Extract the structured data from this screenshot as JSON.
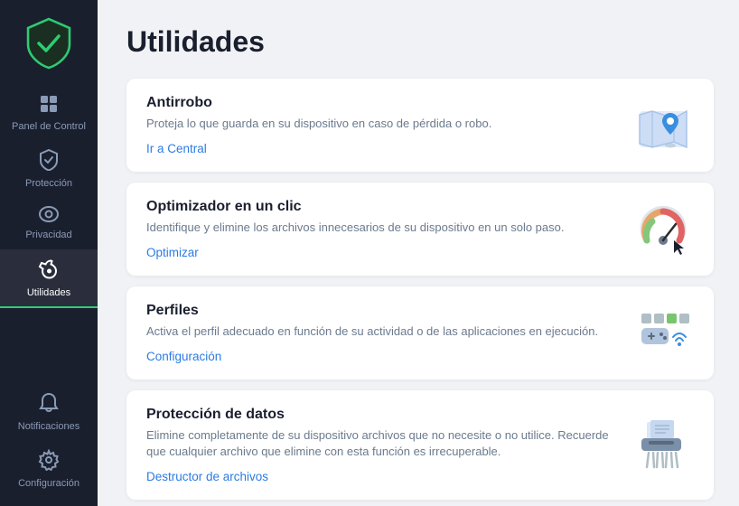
{
  "sidebar": {
    "items": [
      {
        "id": "panel",
        "label": "Panel de Control",
        "icon": "⊞",
        "active": false
      },
      {
        "id": "proteccion",
        "label": "Protección",
        "icon": "🛡",
        "active": false
      },
      {
        "id": "privacidad",
        "label": "Privacidad",
        "icon": "👁",
        "active": false
      },
      {
        "id": "utilidades",
        "label": "Utilidades",
        "icon": "🔧",
        "active": true
      }
    ],
    "bottom_items": [
      {
        "id": "notificaciones",
        "label": "Notificaciones",
        "icon": "🔔"
      },
      {
        "id": "configuracion",
        "label": "Configuración",
        "icon": "⚙"
      }
    ]
  },
  "main": {
    "title": "Utilidades",
    "cards": [
      {
        "id": "antirrobo",
        "title": "Antirrobo",
        "desc": "Proteja lo que guarda en su dispositivo en caso de pérdida o robo.",
        "link_label": "Ir a Central"
      },
      {
        "id": "optimizador",
        "title": "Optimizador en un clic",
        "desc": "Identifique y elimine los archivos innecesarios de su dispositivo en un solo paso.",
        "link_label": "Optimizar"
      },
      {
        "id": "perfiles",
        "title": "Perfiles",
        "desc": "Activa el perfil adecuado en función de su actividad o de las aplicaciones en ejecución.",
        "link_label": "Configuración"
      },
      {
        "id": "proteccion-datos",
        "title": "Protección de datos",
        "desc": "Elimine completamente de su dispositivo archivos que no necesite o no utilice. Recuerde que cualquier archivo que elimine con esta función es irrecuperable.",
        "link_label": "Destructor de archivos"
      }
    ]
  },
  "colors": {
    "accent_blue": "#2c7be5",
    "sidebar_bg": "#1a1f2e",
    "active_text": "#ffffff",
    "inactive_text": "#8a9bb5",
    "green": "#2ecc71"
  }
}
